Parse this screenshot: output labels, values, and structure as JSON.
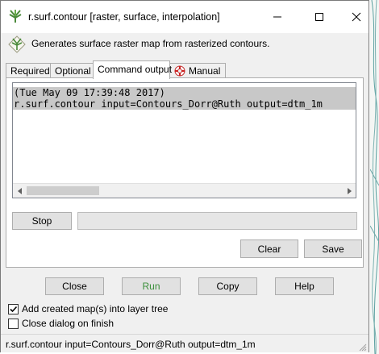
{
  "window": {
    "title": "r.surf.contour [raster, surface, interpolation]",
    "description": "Generates surface raster map from rasterized contours."
  },
  "tabs": [
    {
      "label": "Required",
      "active": false
    },
    {
      "label": "Optional",
      "active": false
    },
    {
      "label": "Command output",
      "active": true
    },
    {
      "label": "Manual",
      "active": false
    }
  ],
  "output": {
    "lines": [
      "(Tue May 09 17:39:48 2017)",
      "r.surf.contour input=Contours_Dorr@Ruth output=dtm_1m"
    ]
  },
  "panel_buttons": {
    "stop": "Stop",
    "clear": "Clear",
    "save": "Save"
  },
  "actions": {
    "close": "Close",
    "run": "Run",
    "copy": "Copy",
    "help": "Help"
  },
  "options": {
    "add_to_layer_tree": {
      "label": "Add created map(s) into layer tree",
      "checked": true
    },
    "close_on_finish": {
      "label": "Close dialog on finish",
      "checked": false
    }
  },
  "status": {
    "text": "r.surf.contour input=Contours_Dorr@Ruth output=dtm_1m"
  },
  "colors": {
    "run_text": "#3a8f3a",
    "selection": "#c8c8c8"
  }
}
